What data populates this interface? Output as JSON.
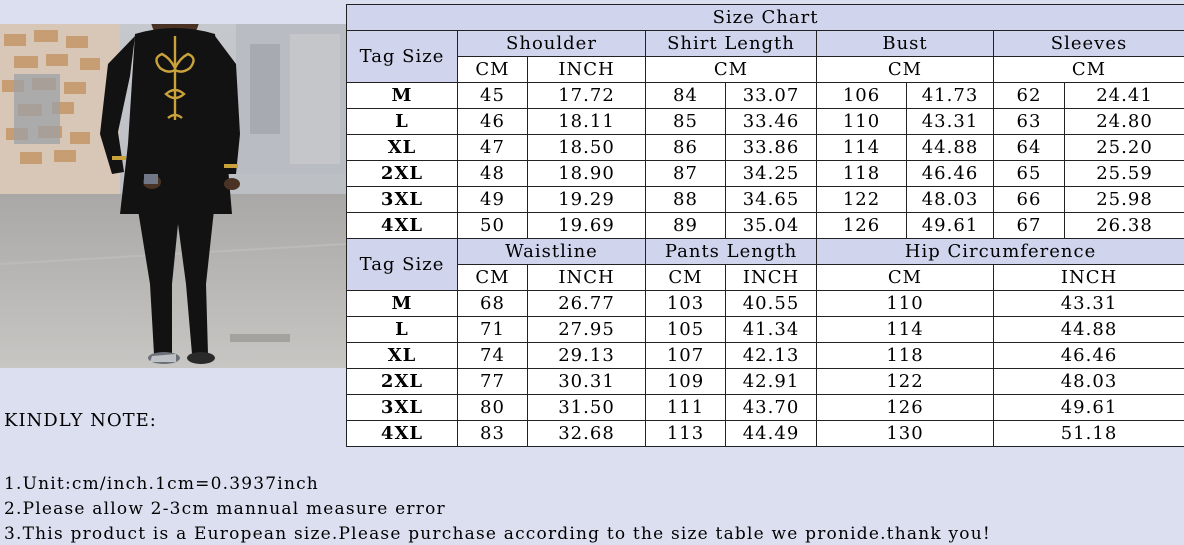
{
  "title": "Size Chart",
  "tag_size_label": "Tag Size",
  "table1": {
    "groups": [
      "Shoulder",
      "Shirt Length",
      "Bust",
      "Sleeves"
    ],
    "units": [
      "CM",
      "INCH",
      "CM",
      "CM",
      "CM"
    ],
    "rows": [
      {
        "size": "M",
        "cells": [
          "45",
          "17.72",
          "84",
          "33.07",
          "106",
          "41.73",
          "62",
          "24.41"
        ]
      },
      {
        "size": "L",
        "cells": [
          "46",
          "18.11",
          "85",
          "33.46",
          "110",
          "43.31",
          "63",
          "24.80"
        ]
      },
      {
        "size": "XL",
        "cells": [
          "47",
          "18.50",
          "86",
          "33.86",
          "114",
          "44.88",
          "64",
          "25.20"
        ]
      },
      {
        "size": "2XL",
        "cells": [
          "48",
          "18.90",
          "87",
          "34.25",
          "118",
          "46.46",
          "65",
          "25.59"
        ]
      },
      {
        "size": "3XL",
        "cells": [
          "49",
          "19.29",
          "88",
          "34.65",
          "122",
          "48.03",
          "66",
          "25.98"
        ]
      },
      {
        "size": "4XL",
        "cells": [
          "50",
          "19.69",
          "89",
          "35.04",
          "126",
          "49.61",
          "67",
          "26.38"
        ]
      }
    ]
  },
  "table2": {
    "groups": [
      "Waistline",
      "Pants Length",
      "Hip Circumference"
    ],
    "units": [
      "CM",
      "INCH",
      "CM",
      "INCH",
      "CM",
      "INCH"
    ],
    "rows": [
      {
        "size": "M",
        "cells": [
          "68",
          "26.77",
          "103",
          "40.55",
          "110",
          "43.31"
        ]
      },
      {
        "size": "L",
        "cells": [
          "71",
          "27.95",
          "105",
          "41.34",
          "114",
          "44.88"
        ]
      },
      {
        "size": "XL",
        "cells": [
          "74",
          "29.13",
          "107",
          "42.13",
          "118",
          "46.46"
        ]
      },
      {
        "size": "2XL",
        "cells": [
          "77",
          "30.31",
          "109",
          "42.91",
          "122",
          "48.03"
        ]
      },
      {
        "size": "3XL",
        "cells": [
          "80",
          "31.50",
          "111",
          "43.70",
          "126",
          "49.61"
        ]
      },
      {
        "size": "4XL",
        "cells": [
          "83",
          "32.68",
          "113",
          "44.49",
          "130",
          "51.18"
        ]
      }
    ]
  },
  "note": {
    "heading": "KINDLY NOTE:",
    "lines": [
      "1.Unit:cm/inch.1cm=0.3937inch",
      "2.Please allow 2-3cm mannual measure error",
      "3.This product is a European size.Please purchase according to the size table we pronide.thank you!"
    ]
  },
  "colors": {
    "header_fill": "#d0d4ec",
    "panel_fill": "#dcdff0",
    "cell_fill": "#ffffff",
    "garment": "#121212",
    "embroidery_gold": "#c9a23c"
  },
  "photo_icon": "model-photo"
}
